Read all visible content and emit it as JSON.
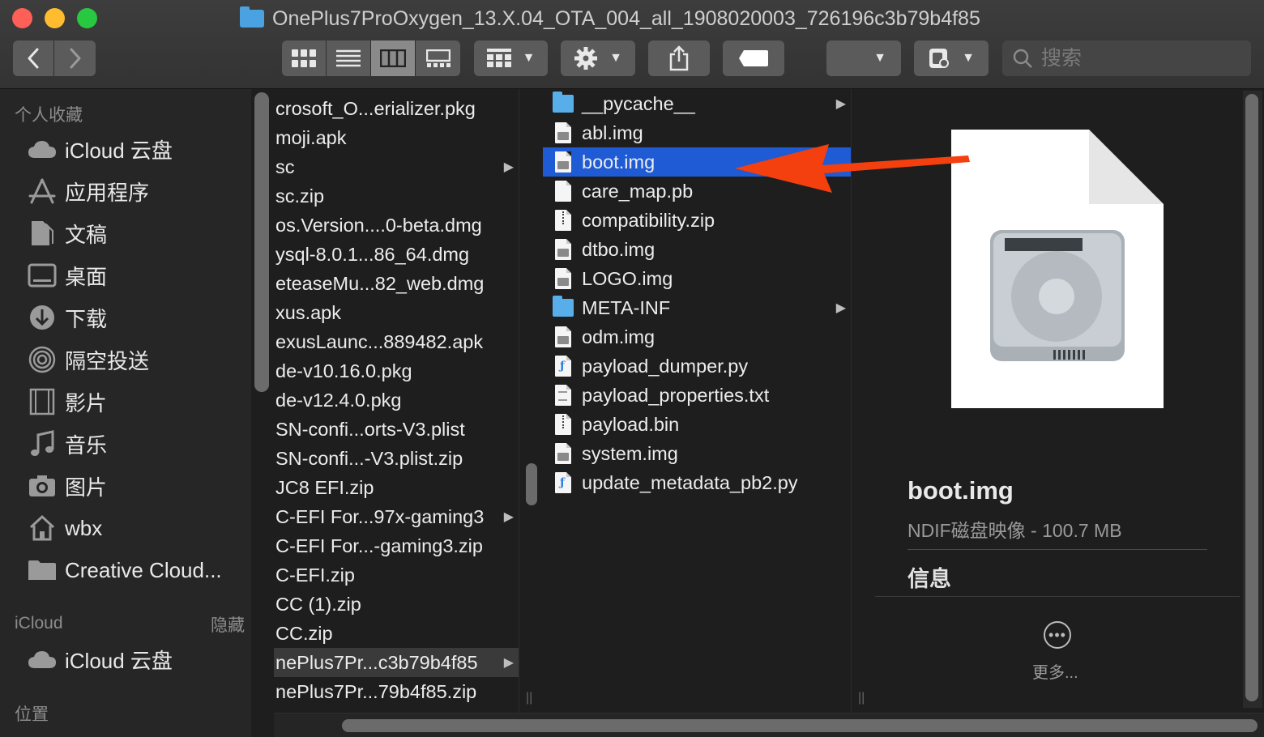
{
  "window": {
    "title": "OnePlus7ProOxygen_13.X.04_OTA_004_all_1908020003_726196c3b79b4f85"
  },
  "toolbar": {
    "search_placeholder": "搜索",
    "accent": "#1f5bd4"
  },
  "sidebar": {
    "favorites_header": "个人收藏",
    "favorites": [
      {
        "label": "iCloud 云盘",
        "icon": "cloud-icon"
      },
      {
        "label": "应用程序",
        "icon": "applications-icon"
      },
      {
        "label": "文稿",
        "icon": "documents-icon"
      },
      {
        "label": "桌面",
        "icon": "desktop-icon"
      },
      {
        "label": "下载",
        "icon": "download-icon"
      },
      {
        "label": "隔空投送",
        "icon": "airdrop-icon"
      },
      {
        "label": "影片",
        "icon": "movies-icon"
      },
      {
        "label": "音乐",
        "icon": "music-icon"
      },
      {
        "label": "图片",
        "icon": "pictures-icon"
      },
      {
        "label": "wbx",
        "icon": "home-icon"
      },
      {
        "label": "Creative Cloud...",
        "icon": "folder-icon"
      }
    ],
    "icloud_header": "iCloud",
    "icloud_hide": "隐藏",
    "icloud_items": [
      {
        "label": "iCloud 云盘",
        "icon": "cloud-icon"
      }
    ],
    "locations_header": "位置"
  },
  "column1": {
    "rows": [
      {
        "name": "crosoft_O...erializer.pkg",
        "folder": false
      },
      {
        "name": "moji.apk",
        "folder": false
      },
      {
        "name": "sc",
        "folder": true
      },
      {
        "name": "sc.zip",
        "folder": false
      },
      {
        "name": "os.Version....0-beta.dmg",
        "folder": false
      },
      {
        "name": "ysql-8.0.1...86_64.dmg",
        "folder": false
      },
      {
        "name": "eteaseMu...82_web.dmg",
        "folder": false
      },
      {
        "name": "xus.apk",
        "folder": false
      },
      {
        "name": "exusLaunc...889482.apk",
        "folder": false
      },
      {
        "name": "de-v10.16.0.pkg",
        "folder": false
      },
      {
        "name": "de-v12.4.0.pkg",
        "folder": false
      },
      {
        "name": "SN-confi...orts-V3.plist",
        "folder": false
      },
      {
        "name": "SN-confi...-V3.plist.zip",
        "folder": false
      },
      {
        "name": "JC8 EFI.zip",
        "folder": false
      },
      {
        "name": "C-EFI For...97x-gaming3",
        "folder": true
      },
      {
        "name": "C-EFI For...-gaming3.zip",
        "folder": false
      },
      {
        "name": "C-EFI.zip",
        "folder": false
      },
      {
        "name": "CC (1).zip",
        "folder": false
      },
      {
        "name": "CC.zip",
        "folder": false
      },
      {
        "name": "nePlus7Pr...c3b79b4f85",
        "folder": true
      },
      {
        "name": "nePlus7Pr...79b4f85.zip",
        "folder": false
      }
    ]
  },
  "column2": {
    "rows": [
      {
        "name": "__pycache__",
        "kind": "folder"
      },
      {
        "name": "abl.img",
        "kind": "disk"
      },
      {
        "name": "boot.img",
        "kind": "disk"
      },
      {
        "name": "care_map.pb",
        "kind": "doc"
      },
      {
        "name": "compatibility.zip",
        "kind": "zip"
      },
      {
        "name": "dtbo.img",
        "kind": "disk"
      },
      {
        "name": "LOGO.img",
        "kind": "disk"
      },
      {
        "name": "META-INF",
        "kind": "folder"
      },
      {
        "name": "odm.img",
        "kind": "disk"
      },
      {
        "name": "payload_dumper.py",
        "kind": "py"
      },
      {
        "name": "payload_properties.txt",
        "kind": "txt"
      },
      {
        "name": "payload.bin",
        "kind": "zip"
      },
      {
        "name": "system.img",
        "kind": "disk"
      },
      {
        "name": "update_metadata_pb2.py",
        "kind": "py"
      }
    ],
    "selected_index": 2
  },
  "preview": {
    "name": "boot.img",
    "meta": "NDIF磁盘映像 - 100.7 MB",
    "info_header": "信息",
    "more_label": "更多..."
  },
  "annotation": {
    "arrow_color": "#f43f0f"
  }
}
